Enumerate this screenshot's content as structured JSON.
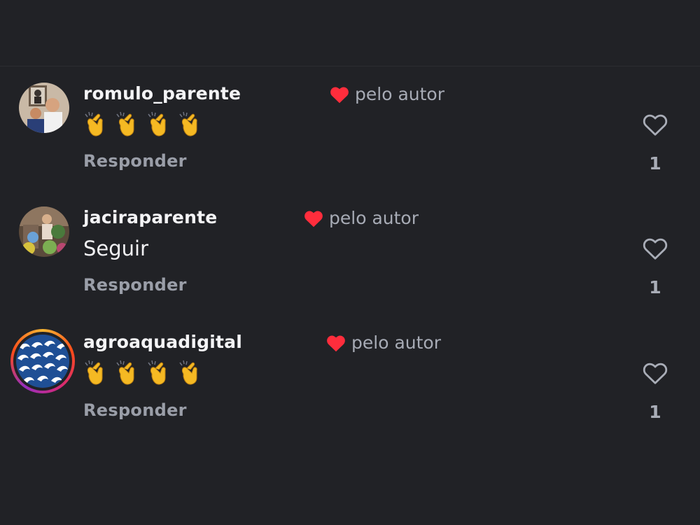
{
  "comments": [
    {
      "username": "romulo_parente",
      "author_label": "pelo autor",
      "body_type": "emoji",
      "emoji": [
        "👏",
        "👏",
        "👏",
        "👏"
      ],
      "reply_label": "Responder",
      "like_count": "1",
      "avatar": "portrait-photo"
    },
    {
      "username": "jaciraparente",
      "author_label": "pelo autor",
      "body_type": "text",
      "text": "Seguir",
      "reply_label": "Responder",
      "like_count": "1",
      "avatar": "garden-photo"
    },
    {
      "username": "agroaquadigital",
      "author_label": "pelo autor",
      "body_type": "emoji",
      "emoji": [
        "👏",
        "👏",
        "👏",
        "👏"
      ],
      "reply_label": "Responder",
      "like_count": "1",
      "avatar": "blue-wave-logo"
    }
  ],
  "colors": {
    "background": "#212226",
    "heart_red": "#ff2d3c",
    "username": "#f4f4f6",
    "secondary_text": "#a7abb5"
  },
  "icons": {
    "author_like": "heart-filled-icon",
    "like": "heart-outline-icon"
  }
}
